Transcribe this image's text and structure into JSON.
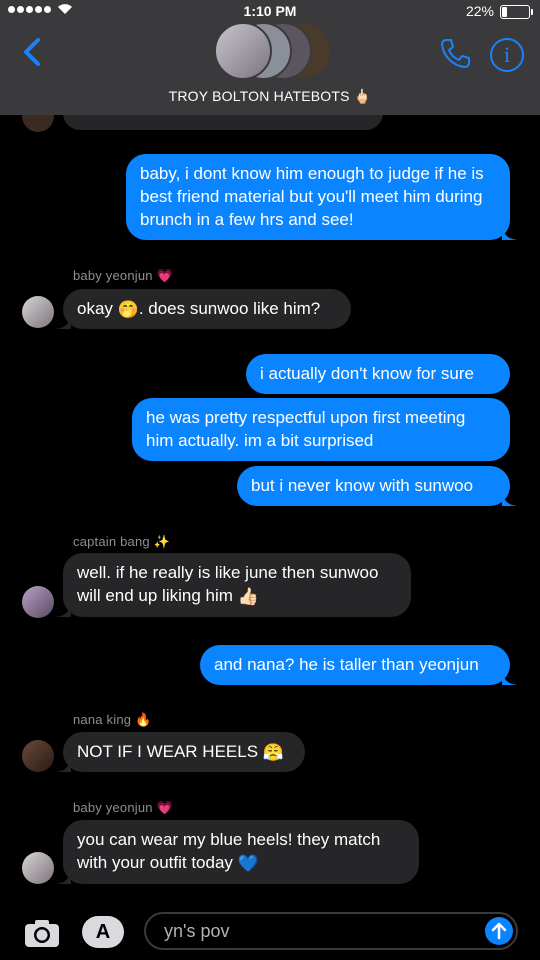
{
  "status": {
    "time": "1:10 PM",
    "battery": "22%",
    "battery_level": 0.22
  },
  "header": {
    "group_name": "TROY BOLTON HATEBOTS 🖕🏻"
  },
  "messages": {
    "m1": "baby, i dont know him enough to judge if he is best friend material but you'll meet him during brunch in a few hrs and see!",
    "s1": "baby yeonjun 💗",
    "m2a": "okay ",
    "m2emoji": "🤭",
    "m2b": ". does sunwoo like him?",
    "m3": "i actually don't know for sure",
    "m4": "he was pretty respectful upon first meeting him actually. im a bit surprised",
    "m5": "but i never know with sunwoo",
    "s2": "captain bang ✨",
    "m6a": "well. if he really is like june then sunwoo will end up liking him ",
    "m6emoji": "👍🏻",
    "m7": "and nana? he is taller than yeonjun",
    "s3": "nana king 🔥",
    "m8a": "NOT IF I WEAR HEELS ",
    "m8emoji": "😤",
    "s4": "baby yeonjun 💗",
    "m9a": "you can wear my blue heels! they match with your outfit today ",
    "m9emoji": "💙"
  },
  "input": {
    "text": "yn's pov"
  },
  "colors": {
    "accent": "#0a84ff",
    "incoming": "#262628",
    "header": "#3a3a3c"
  }
}
